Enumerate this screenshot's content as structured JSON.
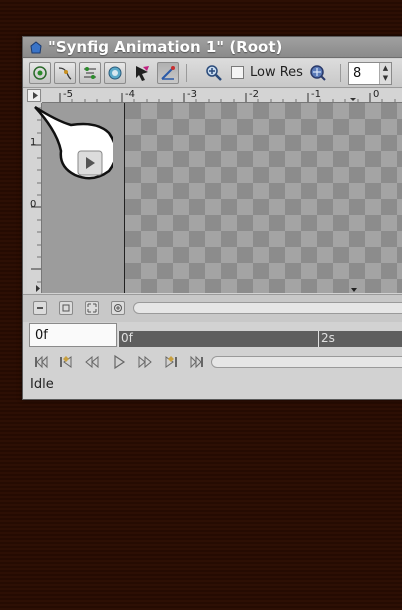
{
  "window": {
    "title": "\"Synfig Animation 1\" (Root)"
  },
  "toolbar": {
    "icons": [
      "show-grid-icon",
      "show-guides-icon",
      "onion-skin-icon",
      "background-icon",
      "tool-arrow-icon",
      "pen-tool-icon",
      "zoom-in-icon",
      "zoom-out-icon"
    ],
    "lowres_label": "Low Res",
    "lowres_checked": false,
    "quality_value": "8"
  },
  "hruler": {
    "ticks": [
      "-5",
      "-4",
      "-3",
      "-2",
      "-1",
      "0"
    ]
  },
  "vruler": {
    "ticks": [
      "1",
      "0",
      "-1"
    ]
  },
  "timebar": {
    "frame_value": "0f",
    "start_label": "0f",
    "mark_label": "2s"
  },
  "transport": {
    "icons": [
      "seek-begin-icon",
      "prev-keyframe-icon",
      "prev-frame-icon",
      "play-icon",
      "next-frame-icon",
      "next-keyframe-icon",
      "seek-end-icon"
    ]
  },
  "status": {
    "text": "Idle"
  },
  "colors": {
    "desktop": "#2d0f04",
    "titlebar": "#959595",
    "timebar": "#5e5e5e",
    "keyframe": "#c8a040"
  }
}
